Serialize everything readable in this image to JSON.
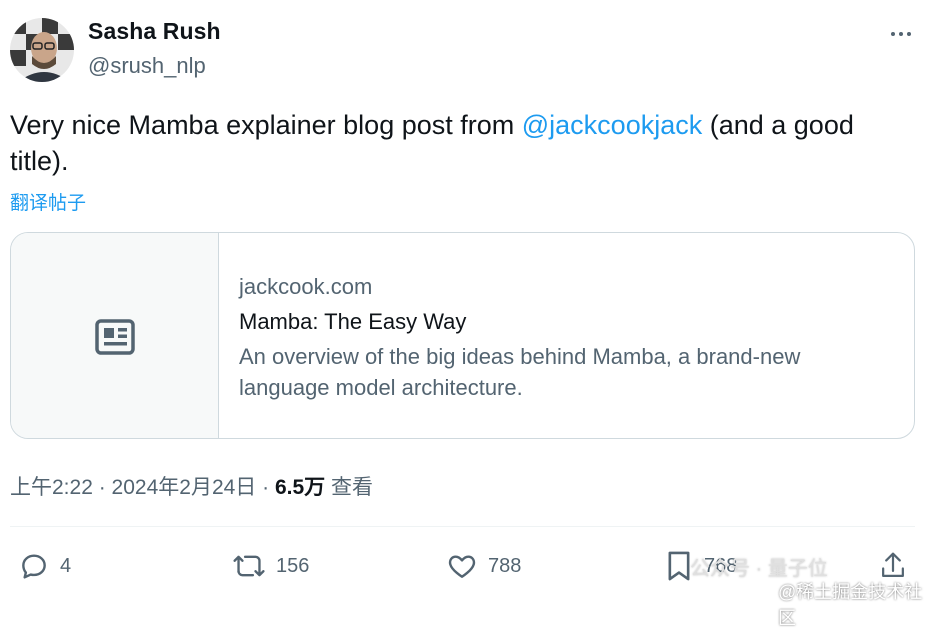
{
  "author": {
    "name": "Sasha Rush",
    "handle": "@srush_nlp"
  },
  "more_icon": "more-horizontal-icon",
  "tweet": {
    "text_before": "Very nice Mamba explainer blog post from ",
    "mention": "@jackcookjack",
    "text_after": " (and a good title).",
    "translate_label": "翻译帖子"
  },
  "card": {
    "thumbnail_icon": "article-icon",
    "domain": "jackcook.com",
    "title": "Mamba: The Easy Way",
    "description": "An overview of the big ideas behind Mamba, a brand-new language model architecture."
  },
  "meta": {
    "time": "上午2:22",
    "separator": " · ",
    "date": "2024年2月24日",
    "views_count": "6.5万",
    "views_label": " 查看"
  },
  "actions": {
    "reply_count": "4",
    "retweet_count": "156",
    "like_count": "788",
    "bookmark_count": "768"
  },
  "watermark": {
    "line1": "公众号 · 量子位",
    "line2": "@稀土掘金技术社区"
  },
  "colors": {
    "accent": "#1d9bf0",
    "secondary_text": "#536471",
    "border": "#cfd9de"
  }
}
